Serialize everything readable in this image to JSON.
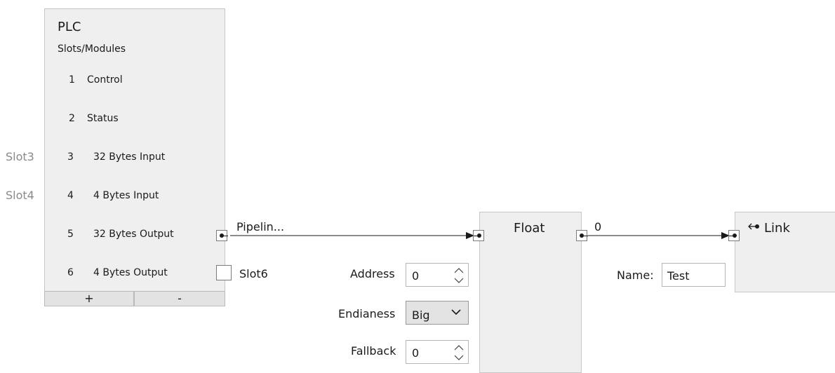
{
  "plc": {
    "title": "PLC",
    "subtitle": "Slots/Modules",
    "slots": [
      {
        "num": "1",
        "label": "Control"
      },
      {
        "num": "2",
        "label": "Status"
      },
      {
        "num": "3",
        "label": "32 Bytes Input"
      },
      {
        "num": "4",
        "label": "4 Bytes Input"
      },
      {
        "num": "5",
        "label": "32 Bytes Output"
      },
      {
        "num": "6",
        "label": "4 Bytes Output"
      }
    ],
    "add_label": "+",
    "remove_label": "-"
  },
  "external_labels": {
    "slot3": "Slot3",
    "slot4": "Slot4",
    "slot6": "Slot6"
  },
  "pipeline_label": "Pipelin...",
  "float_node": {
    "title": "Float",
    "output_value": "0",
    "address_label": "Address",
    "address_value": "0",
    "endianess_label": "Endianess",
    "endianess_value": "Big",
    "fallback_label": "Fallback",
    "fallback_value": "0"
  },
  "link_node": {
    "title": "Link",
    "name_label": "Name:",
    "name_value": "Test"
  },
  "icons": {
    "spin_up": "chevron-up",
    "spin_down": "chevron-down",
    "dropdown": "chevron-down",
    "link": "link-arrow"
  }
}
